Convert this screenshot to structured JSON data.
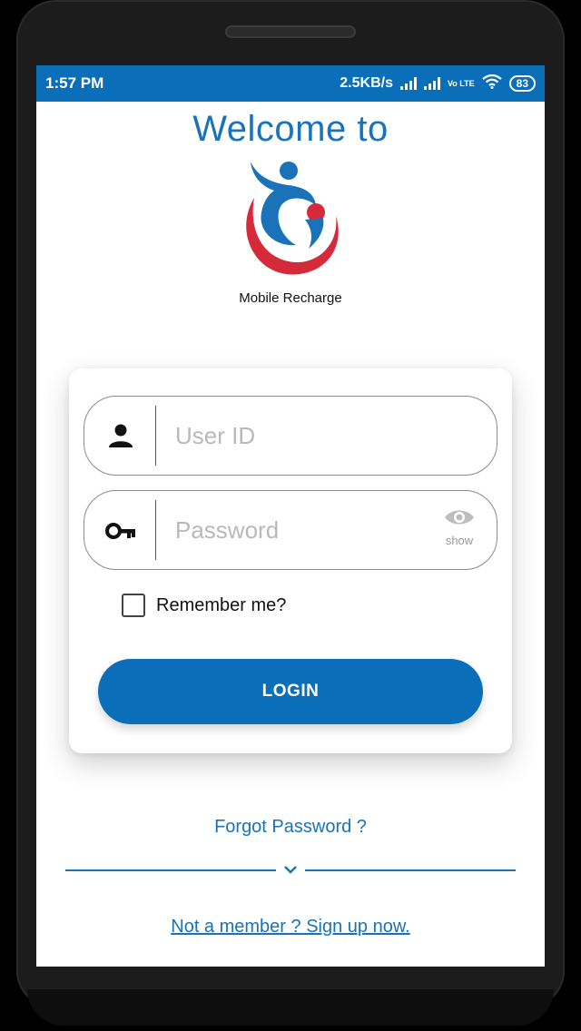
{
  "status_bar": {
    "time": "1:57 PM",
    "network_speed": "2.5KB/s",
    "network_type": "Vo LTE",
    "battery": "83",
    "icons": [
      "signal-icon",
      "signal-icon",
      "volte-icon",
      "wifi-icon",
      "battery-icon"
    ]
  },
  "header": {
    "welcome": "Welcome to",
    "brand_name": "Mobile Recharge"
  },
  "login_form": {
    "user_id": {
      "placeholder": "User ID",
      "value": "",
      "icon": "person-icon"
    },
    "password": {
      "placeholder": "Password",
      "value": "",
      "icon": "key-icon",
      "toggle_label": "show",
      "toggle_icon": "eye-icon"
    },
    "remember_me": {
      "label": "Remember me?",
      "checked": false
    },
    "login_label": "LOGIN"
  },
  "footer": {
    "forgot_password": "Forgot Password ?",
    "signup": "Not a member ? Sign up now."
  },
  "colors": {
    "primary": "#0a6fb8",
    "brand_red": "#d42a3a",
    "background": "#ffffff"
  }
}
